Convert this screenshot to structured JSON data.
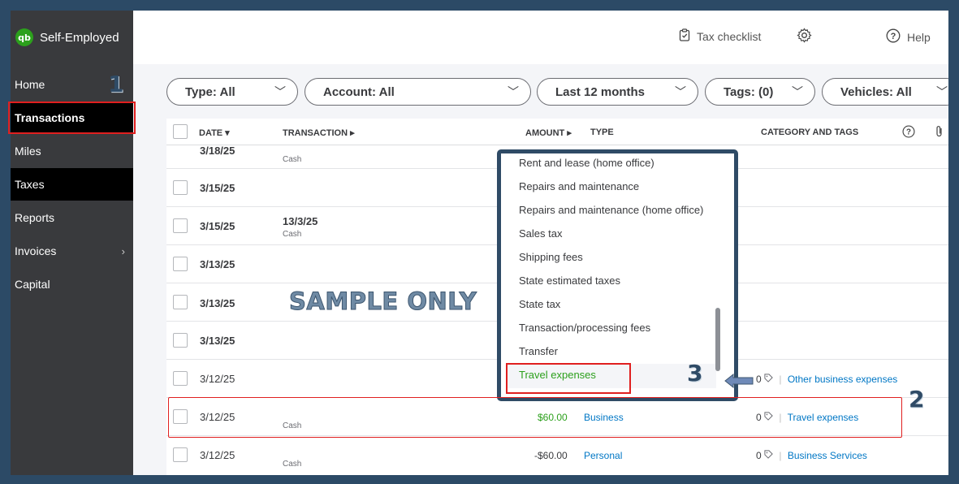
{
  "app": {
    "brand": "Self-Employed",
    "brand_logo": "qb"
  },
  "sidebar": {
    "items": [
      {
        "label": "Home"
      },
      {
        "label": "Transactions"
      },
      {
        "label": "Miles"
      },
      {
        "label": "Taxes"
      },
      {
        "label": "Reports"
      },
      {
        "label": "Invoices",
        "chevron": "›"
      },
      {
        "label": "Capital"
      }
    ]
  },
  "topbar": {
    "tax_checklist": "Tax checklist",
    "help": "Help"
  },
  "filters": {
    "type": "Type: All",
    "account": "Account: All",
    "period": "Last 12 months",
    "tags": "Tags: (0)",
    "vehicles": "Vehicles: All"
  },
  "table": {
    "headers": {
      "date": "DATE ▾",
      "transaction": "TRANSACTION ▸",
      "amount": "AMOUNT ▸",
      "type": "TYPE",
      "category": "CATEGORY AND TAGS"
    },
    "rows": [
      {
        "date": "3/18/25",
        "transaction": "",
        "sub": "Cash"
      },
      {
        "date": "3/15/25",
        "transaction": "",
        "sub": ""
      },
      {
        "date": "3/15/25",
        "transaction": "13/3/25",
        "sub": "Cash"
      },
      {
        "date": "3/13/25",
        "transaction": "",
        "sub": ""
      },
      {
        "date": "3/13/25",
        "transaction": "",
        "sub": ""
      },
      {
        "date": "3/13/25",
        "transaction": "",
        "sub": ""
      },
      {
        "date": "3/12/25",
        "transaction": "",
        "sub": "",
        "tags": "0",
        "category": "Other business expenses"
      },
      {
        "date": "3/12/25",
        "transaction": "",
        "sub": "Cash",
        "amount": "$60.00",
        "type": "Business",
        "tags": "0",
        "category": "Travel expenses"
      },
      {
        "date": "3/12/25",
        "transaction": "",
        "sub": "Cash",
        "amount": "-$60.00",
        "type": "Personal",
        "tags": "0",
        "category": "Business Services"
      }
    ]
  },
  "dropdown": {
    "items": [
      "Rent and lease (home office)",
      "Repairs and maintenance",
      "Repairs and maintenance (home office)",
      "Sales tax",
      "Shipping fees",
      "State estimated taxes",
      "State tax",
      "Transaction/processing fees",
      "Transfer",
      "Travel expenses"
    ]
  },
  "annotations": {
    "n1": "1",
    "n2": "2",
    "n3": "3",
    "watermark": "SAMPLE ONLY"
  },
  "colors": {
    "accent_green": "#2ca01c",
    "link_blue": "#0077c5",
    "frame": "#2f4b66",
    "annotation_red": "#e01f1f"
  }
}
